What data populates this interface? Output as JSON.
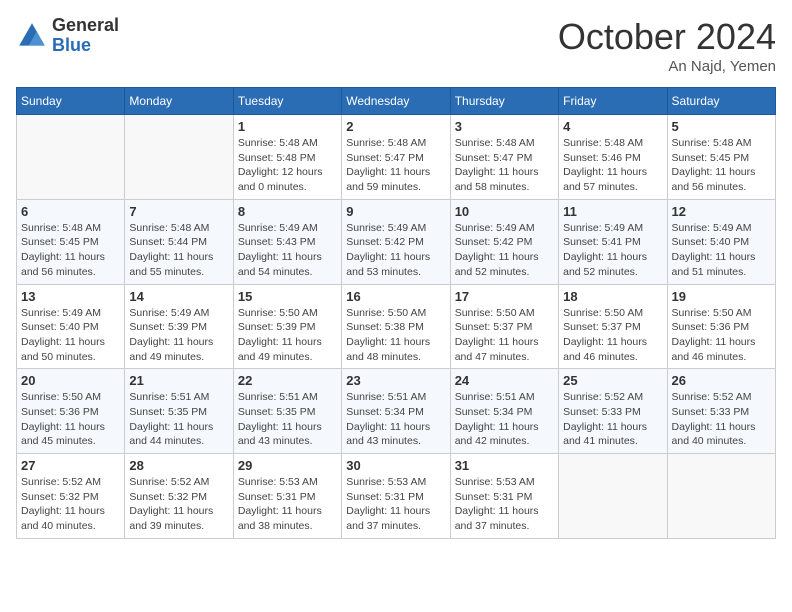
{
  "header": {
    "logo_general": "General",
    "logo_blue": "Blue",
    "month_title": "October 2024",
    "location": "An Najd, Yemen"
  },
  "days_of_week": [
    "Sunday",
    "Monday",
    "Tuesday",
    "Wednesday",
    "Thursday",
    "Friday",
    "Saturday"
  ],
  "weeks": [
    [
      {
        "day": "",
        "info": ""
      },
      {
        "day": "",
        "info": ""
      },
      {
        "day": "1",
        "sunrise": "5:48 AM",
        "sunset": "5:48 PM",
        "daylight": "12 hours and 0 minutes."
      },
      {
        "day": "2",
        "sunrise": "5:48 AM",
        "sunset": "5:47 PM",
        "daylight": "11 hours and 59 minutes."
      },
      {
        "day": "3",
        "sunrise": "5:48 AM",
        "sunset": "5:47 PM",
        "daylight": "11 hours and 58 minutes."
      },
      {
        "day": "4",
        "sunrise": "5:48 AM",
        "sunset": "5:46 PM",
        "daylight": "11 hours and 57 minutes."
      },
      {
        "day": "5",
        "sunrise": "5:48 AM",
        "sunset": "5:45 PM",
        "daylight": "11 hours and 56 minutes."
      }
    ],
    [
      {
        "day": "6",
        "sunrise": "5:48 AM",
        "sunset": "5:45 PM",
        "daylight": "11 hours and 56 minutes."
      },
      {
        "day": "7",
        "sunrise": "5:48 AM",
        "sunset": "5:44 PM",
        "daylight": "11 hours and 55 minutes."
      },
      {
        "day": "8",
        "sunrise": "5:49 AM",
        "sunset": "5:43 PM",
        "daylight": "11 hours and 54 minutes."
      },
      {
        "day": "9",
        "sunrise": "5:49 AM",
        "sunset": "5:42 PM",
        "daylight": "11 hours and 53 minutes."
      },
      {
        "day": "10",
        "sunrise": "5:49 AM",
        "sunset": "5:42 PM",
        "daylight": "11 hours and 52 minutes."
      },
      {
        "day": "11",
        "sunrise": "5:49 AM",
        "sunset": "5:41 PM",
        "daylight": "11 hours and 52 minutes."
      },
      {
        "day": "12",
        "sunrise": "5:49 AM",
        "sunset": "5:40 PM",
        "daylight": "11 hours and 51 minutes."
      }
    ],
    [
      {
        "day": "13",
        "sunrise": "5:49 AM",
        "sunset": "5:40 PM",
        "daylight": "11 hours and 50 minutes."
      },
      {
        "day": "14",
        "sunrise": "5:49 AM",
        "sunset": "5:39 PM",
        "daylight": "11 hours and 49 minutes."
      },
      {
        "day": "15",
        "sunrise": "5:50 AM",
        "sunset": "5:39 PM",
        "daylight": "11 hours and 49 minutes."
      },
      {
        "day": "16",
        "sunrise": "5:50 AM",
        "sunset": "5:38 PM",
        "daylight": "11 hours and 48 minutes."
      },
      {
        "day": "17",
        "sunrise": "5:50 AM",
        "sunset": "5:37 PM",
        "daylight": "11 hours and 47 minutes."
      },
      {
        "day": "18",
        "sunrise": "5:50 AM",
        "sunset": "5:37 PM",
        "daylight": "11 hours and 46 minutes."
      },
      {
        "day": "19",
        "sunrise": "5:50 AM",
        "sunset": "5:36 PM",
        "daylight": "11 hours and 46 minutes."
      }
    ],
    [
      {
        "day": "20",
        "sunrise": "5:50 AM",
        "sunset": "5:36 PM",
        "daylight": "11 hours and 45 minutes."
      },
      {
        "day": "21",
        "sunrise": "5:51 AM",
        "sunset": "5:35 PM",
        "daylight": "11 hours and 44 minutes."
      },
      {
        "day": "22",
        "sunrise": "5:51 AM",
        "sunset": "5:35 PM",
        "daylight": "11 hours and 43 minutes."
      },
      {
        "day": "23",
        "sunrise": "5:51 AM",
        "sunset": "5:34 PM",
        "daylight": "11 hours and 43 minutes."
      },
      {
        "day": "24",
        "sunrise": "5:51 AM",
        "sunset": "5:34 PM",
        "daylight": "11 hours and 42 minutes."
      },
      {
        "day": "25",
        "sunrise": "5:52 AM",
        "sunset": "5:33 PM",
        "daylight": "11 hours and 41 minutes."
      },
      {
        "day": "26",
        "sunrise": "5:52 AM",
        "sunset": "5:33 PM",
        "daylight": "11 hours and 40 minutes."
      }
    ],
    [
      {
        "day": "27",
        "sunrise": "5:52 AM",
        "sunset": "5:32 PM",
        "daylight": "11 hours and 40 minutes."
      },
      {
        "day": "28",
        "sunrise": "5:52 AM",
        "sunset": "5:32 PM",
        "daylight": "11 hours and 39 minutes."
      },
      {
        "day": "29",
        "sunrise": "5:53 AM",
        "sunset": "5:31 PM",
        "daylight": "11 hours and 38 minutes."
      },
      {
        "day": "30",
        "sunrise": "5:53 AM",
        "sunset": "5:31 PM",
        "daylight": "11 hours and 37 minutes."
      },
      {
        "day": "31",
        "sunrise": "5:53 AM",
        "sunset": "5:31 PM",
        "daylight": "11 hours and 37 minutes."
      },
      {
        "day": "",
        "info": ""
      },
      {
        "day": "",
        "info": ""
      }
    ]
  ]
}
